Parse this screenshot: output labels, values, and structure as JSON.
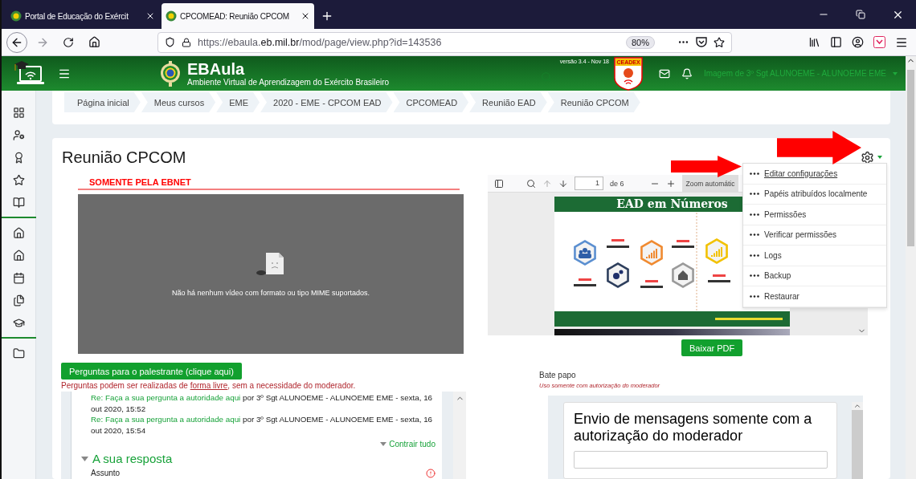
{
  "browser": {
    "tabs": [
      {
        "title": "Portal de Educação do Exércit",
        "selected": false
      },
      {
        "title": "CPCOMEAD: Reunião CPCOM",
        "selected": true
      }
    ],
    "url": "https://ebaula.**eb.mil.br**/mod/page/view.php?id=143536",
    "zoom": "80%"
  },
  "header": {
    "brand": "EBAula",
    "subtitle": "Ambiente Virtual de Aprendizagem do Exército Brasileiro",
    "version": "versão 3.4 - Nov 18",
    "badge": "CEADEX",
    "user": "Imagem de 3º Sgt ALUNOEME - ALUNOEME EME"
  },
  "breadcrumb": [
    "Página inicial",
    "Meus cursos",
    "EME",
    "2020 - EME - CPCOM EAD",
    "CPCOMEAD",
    "Reunião EAD",
    "Reunião CPCOM"
  ],
  "page": {
    "title": "Reunião CPCOM"
  },
  "notice": "SOMENTE PELA EBNET",
  "video": {
    "message": "Não há nenhum vídeo com formato ou tipo MIME suportados."
  },
  "questions": {
    "button": "Perguntas para o palestrante (clique aqui)",
    "note_before": "Perguntas podem ser realizadas de ",
    "note_link": "forma livre",
    "note_after": ", sem a necessidade do moderador."
  },
  "forum": {
    "posts": [
      {
        "link": "Re: Faça a sua pergunta a autoridade aqui",
        "meta": " por 3º Sgt ALUNOEME - ALUNOEME EME - sexta, 16 out 2020, 15:52"
      },
      {
        "link": "Re: Faça a sua pergunta a autoridade aqui",
        "meta": " por 3º Sgt ALUNOEME - ALUNOEME EME - sexta, 16 out 2020, 15:54"
      }
    ],
    "collapse": "Contrair tudo",
    "reply_heading": "A sua resposta",
    "subject_label": "Assunto"
  },
  "pdf": {
    "page": "1",
    "page_count": "de 6",
    "zoom": "Zoom automátic",
    "infographic": {
      "title": "EAD em Números"
    },
    "download": "Baixar PDF"
  },
  "chat": {
    "title": "Bate papo",
    "note": "Uso somente com autorização do moderador",
    "heading": "Envio de mensagens somente com a autorização do moderador"
  },
  "settings_menu": [
    {
      "label": "Editar configurações",
      "selected": true
    },
    {
      "label": "Papéis atribuídos localmente",
      "selected": false
    },
    {
      "label": "Permissões",
      "selected": false
    },
    {
      "label": "Verificar permissões",
      "selected": false
    },
    {
      "label": "Logs",
      "selected": false
    },
    {
      "label": "Backup",
      "selected": false
    },
    {
      "label": "Restaurar",
      "selected": false
    }
  ]
}
